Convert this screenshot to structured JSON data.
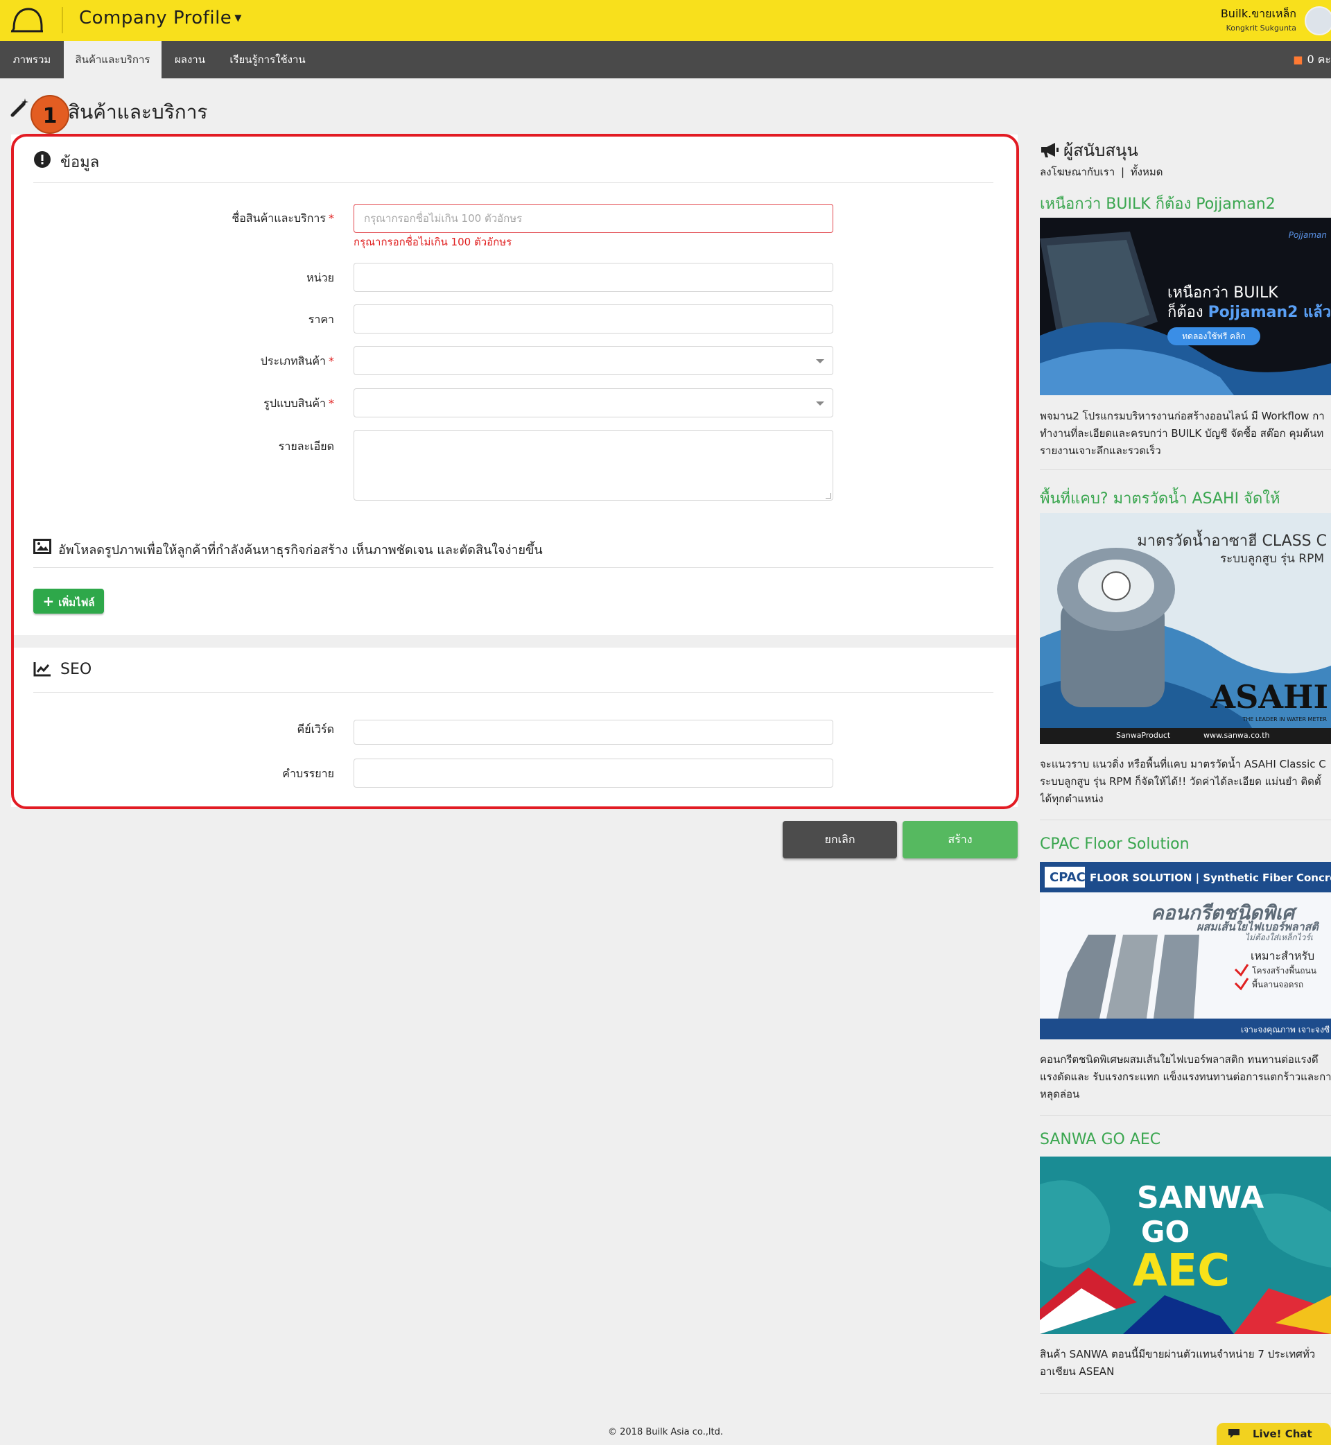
{
  "header": {
    "app_title": "Company Profile",
    "user_name": "Builk.ขายเหล็ก",
    "user_sub": "Kongkrit Sukgunta"
  },
  "nav": {
    "tabs": [
      "ภาพรวม",
      "สินค้าและบริการ",
      "ผลงาน",
      "เรียนรู้การใช้งาน"
    ],
    "active_tab": "สินค้าและบริการ",
    "right_text": "0 คะ"
  },
  "page": {
    "title": "สินค้าและบริการ",
    "step_badge": "1"
  },
  "info_section": {
    "heading": "ข้อมูล",
    "fields": {
      "name_label": "ชื่อสินค้าและบริการ",
      "name_placeholder": "กรุณากรอกชื่อไม่เกิน 100 ตัวอักษร",
      "name_error": "กรุณากรอกชื่อไม่เกิน 100 ตัวอักษร",
      "unit_label": "หน่วย",
      "price_label": "ราคา",
      "category_label": "ประเภทสินค้า",
      "format_label": "รูปแบบสินค้า",
      "detail_label": "รายละเอียด"
    },
    "required_mark": "*"
  },
  "upload_section": {
    "heading": "อัพโหลดรูปภาพเพื่อให้ลูกค้าที่กำลังค้นหาธุรกิจก่อสร้าง เห็นภาพชัดเจน และตัดสินใจง่ายขึ้น",
    "add_file_label": "เพิ่มไฟล์",
    "add_file_icon": "+"
  },
  "seo_section": {
    "heading": "SEO",
    "keyword_label": "คีย์เวิร์ด",
    "description_label": "คำบรรยาย"
  },
  "actions": {
    "cancel_label": "ยกเลิก",
    "create_label": "สร้าง"
  },
  "sidebar": {
    "heading": "ผู้สนับสนุน",
    "sub_links": [
      "ลงโฆษณากับเรา",
      "ทั้งหมด"
    ],
    "sub_sep": "|",
    "ads": [
      {
        "title": "เหนือกว่า BUILK ก็ต้อง Pojjaman2",
        "desc": [
          "พจมาน2 โปรแกรมบริหารงานก่อสร้างออนไลน์ มี Workflow กา",
          "ทำงานที่ละเอียดและครบกว่า BUILK บัญชี จัดซื้อ สต๊อก คุมต้นท",
          "รายงานเจาะลึกและรวดเร็ว"
        ],
        "img_text": {
          "brand": "Pojjaman",
          "line1": "เหนือกว่า BUILK",
          "line2a": "ก็ต้อง ",
          "line2b": "Pojjaman2 แล้ว",
          "cta": "ทดลองใช้ฟรี คลิก"
        }
      },
      {
        "title": "พื้นที่แคบ? มาตรวัดน้ำ ASAHI จัดให้",
        "desc": [
          "จะแนวราบ แนวดิ่ง หรือพื้นที่แคบ มาตรวัดน้ำ ASAHI Classic C",
          "ระบบลูกสูบ รุ่น RPM ก็จัดให้ได้!! วัดค่าได้ละเอียด แม่นยำ ติดตั้",
          "ได้ทุกตำแหน่ง"
        ],
        "img_text": {
          "line1": "มาตรวัดน้ำอาซาฮี CLASS C",
          "line2": "ระบบลูกสูบ รุ่น RPM",
          "brand": "ASAHI",
          "tagline": "THE LEADER IN WATER METER",
          "fb": "SanwaProduct",
          "web": "www.sanwa.co.th"
        }
      },
      {
        "title": "CPAC Floor Solution",
        "desc": [
          "คอนกรีตชนิดพิเศษผสมเส้นใยไฟเบอร์พลาสติก ทนทานต่อแรงดึ",
          "แรงดัดและ รับแรงกระแทก แข็งแรงทนทานต่อการแตกร้าวและกา",
          "หลุดล่อน"
        ],
        "img_text": {
          "logo": "CPAC",
          "band": "FLOOR SOLUTION | Synthetic Fiber Concrete",
          "big": "คอนกรีตชนิดพิเศ",
          "sub": "ผสมเส้นใยไฟเบอร์พลาสติ",
          "sub2": "ไม่ต้องใส่เหล็กไวร์เ",
          "suit": "เหมาะสำหรับ",
          "item1": "โครงสร้างพื้นถนน",
          "item2": "พื้นลานจอดรถ",
          "foot": "เจาะจงคุณภาพ เจาะจงซี"
        }
      },
      {
        "title": "SANWA GO AEC",
        "desc": [
          "สินค้า SANWA ตอนนี้มีขายผ่านตัวแทนจำหน่าย 7 ประเทศทั่ว",
          "อาเซียน ASEAN"
        ],
        "img_text": {
          "line1": "SANWA",
          "line2": "GO",
          "line3": "AEC"
        }
      }
    ]
  },
  "footer": {
    "text": "2018 Builk Asia co.,ltd."
  },
  "chat": {
    "label": "Live! Chat"
  },
  "colors": {
    "header_yellow": "#f8e01c",
    "nav_dark": "#4a4a4a",
    "accent_green": "#3aa64f",
    "error_red": "#e21b23"
  }
}
